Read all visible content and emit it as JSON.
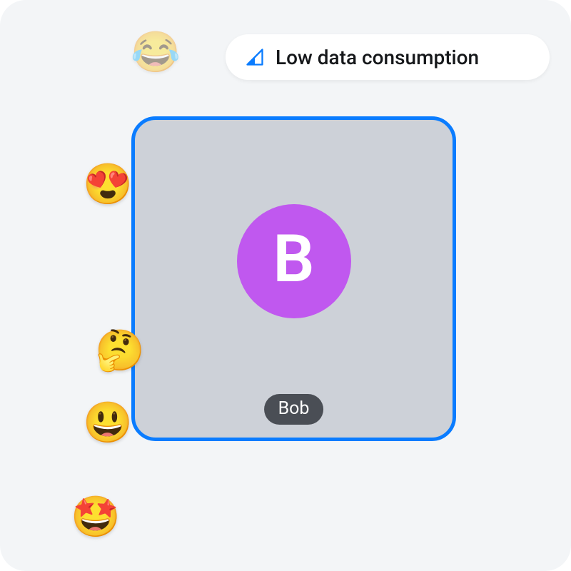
{
  "pill": {
    "label": "Low data consumption",
    "icon_name": "signal-low-icon",
    "icon_color": "#0a7cff"
  },
  "participant": {
    "name": "Bob",
    "initial": "B",
    "avatar_bg": "#c058ef",
    "tile_border": "#0a7cff"
  },
  "reactions": [
    {
      "name": "emoji-joy",
      "glyph": "😂",
      "faded": true
    },
    {
      "name": "emoji-heart-eyes",
      "glyph": "😍",
      "faded": false
    },
    {
      "name": "emoji-thinking",
      "glyph": "🤔",
      "faded": false
    },
    {
      "name": "emoji-smile",
      "glyph": "😃",
      "faded": false
    },
    {
      "name": "emoji-star-eyes",
      "glyph": "🤩",
      "faded": false
    }
  ]
}
